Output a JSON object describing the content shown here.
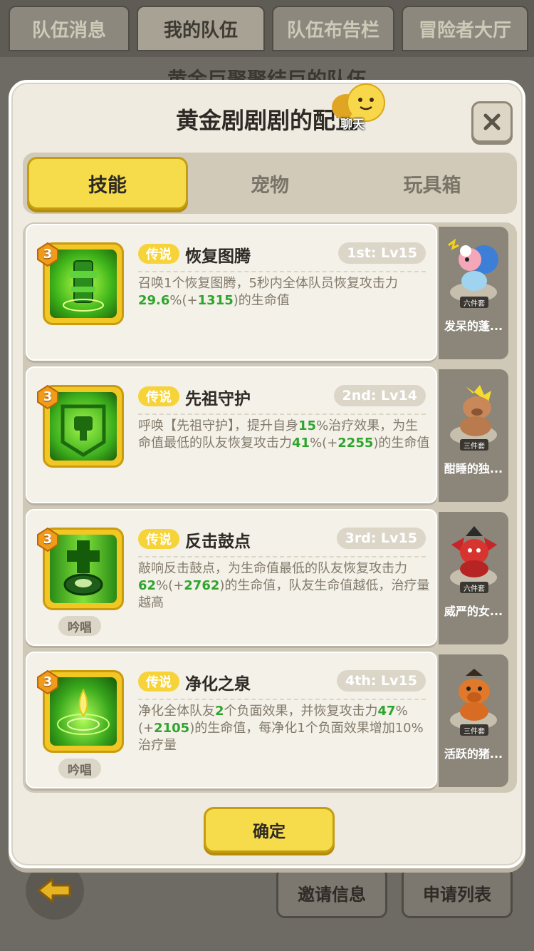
{
  "top_tabs": [
    "队伍消息",
    "我的队伍",
    "队伍布告栏",
    "冒险者大厅"
  ],
  "background_title": "黄金巨聚聚结巨的队伍",
  "modal": {
    "title": "黄金剧剧剧的配置",
    "chat_label": "聊天",
    "tabs": [
      "技能",
      "宠物",
      "玩具箱"
    ],
    "active_tab": 0,
    "confirm_label": "确定"
  },
  "skills": [
    {
      "level": "3",
      "rarity": "传说",
      "name": "恢复图腾",
      "rank": "1st: Lv15",
      "chant": "",
      "desc": [
        {
          "t": "召唤1个恢复图腾，5秒内全体队员恢复攻击力"
        },
        {
          "t": "29.6",
          "g": true
        },
        {
          "t": "%(+"
        },
        {
          "t": "1315",
          "g": true
        },
        {
          "t": ")的生命值"
        }
      ],
      "pet": {
        "set": "六件套",
        "name": "发呆的蓬..."
      }
    },
    {
      "level": "3",
      "rarity": "传说",
      "name": "先祖守护",
      "rank": "2nd: Lv14",
      "chant": "",
      "desc": [
        {
          "t": "呼唤【先祖守护】，提升自身"
        },
        {
          "t": "15",
          "g": true
        },
        {
          "t": "%治疗效果，为生命值最低的队友恢复攻击力"
        },
        {
          "t": "41",
          "g": true
        },
        {
          "t": "%(+"
        },
        {
          "t": "2255",
          "g": true
        },
        {
          "t": ")的生命值"
        }
      ],
      "pet": {
        "set": "三件套",
        "name": "酣睡的独..."
      }
    },
    {
      "level": "3",
      "rarity": "传说",
      "name": "反击鼓点",
      "rank": "3rd: Lv15",
      "chant": "吟唱",
      "desc": [
        {
          "t": "敲响反击鼓点，为生命值最低的队友恢复攻击力"
        },
        {
          "t": "62",
          "g": true
        },
        {
          "t": "%(+"
        },
        {
          "t": "2762",
          "g": true
        },
        {
          "t": ")的生命值，队友生命值越低，治疗量越高"
        }
      ],
      "pet": {
        "set": "六件套",
        "name": "威严的女..."
      }
    },
    {
      "level": "3",
      "rarity": "传说",
      "name": "净化之泉",
      "rank": "4th: Lv15",
      "chant": "吟唱",
      "desc": [
        {
          "t": "净化全体队友"
        },
        {
          "t": "2",
          "g": true
        },
        {
          "t": "个负面效果，并恢复攻击力"
        },
        {
          "t": "47",
          "g": true
        },
        {
          "t": "%(+"
        },
        {
          "t": "2105",
          "g": true
        },
        {
          "t": ")的生命值，每净化1个负面效果增加10%治疗量"
        }
      ],
      "pet": {
        "set": "三件套",
        "name": "活跃的猪..."
      }
    }
  ],
  "bottom_buttons": [
    "邀请信息",
    "申请列表"
  ],
  "colors": {
    "accent": "#f6db4a",
    "highlight": "#2fa52d",
    "rarity": "#f6d338"
  }
}
